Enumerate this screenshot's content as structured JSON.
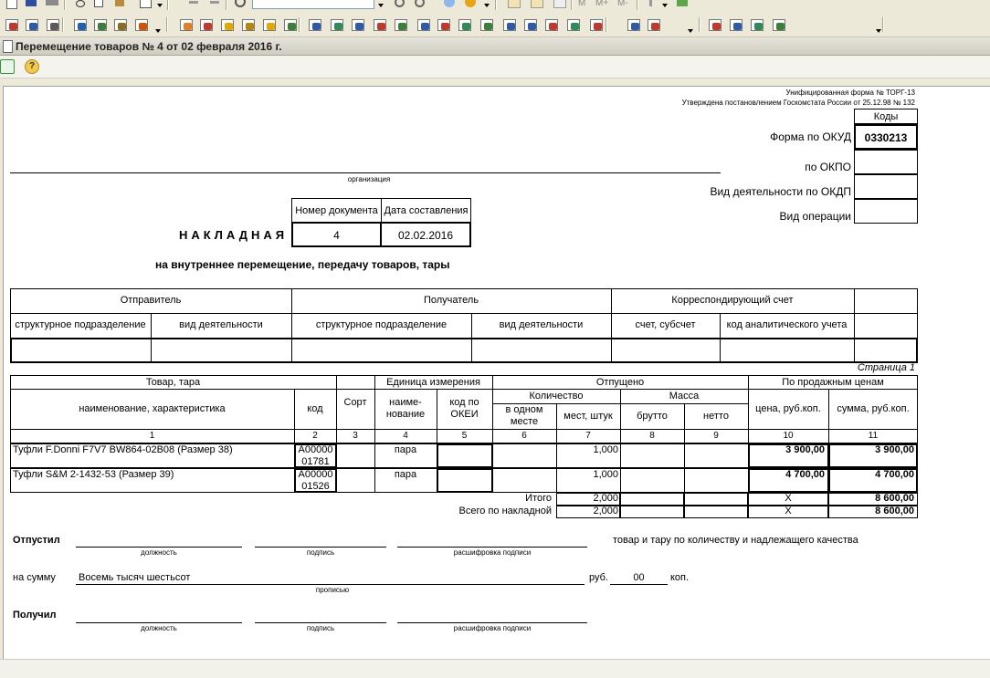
{
  "window": {
    "title": "Перемещение товаров № 4 от 02 февраля 2016 г."
  },
  "form": {
    "header_line1": "Унифицированная форма № ТОРГ-13",
    "header_line2": "Утверждена постановлением Госкомстата России от 25.12.98 № 132",
    "codes_label": "Коды",
    "okud_label": "Форма по ОКУД",
    "okud_value": "0330213",
    "okpo_label": "по ОКПО",
    "okdp_label": "Вид деятельности по ОКДП",
    "op_label": "Вид операции",
    "org_caption": "организация",
    "doc_number_label": "Номер документа",
    "doc_date_label": "Дата составления",
    "doc_number": "4",
    "doc_date": "02.02.2016",
    "title": "НАКЛАДНАЯ",
    "subtitle": "на внутреннее перемещение, передачу товаров, тары",
    "parties": {
      "sender": "Отправитель",
      "receiver": "Получатель",
      "corr_account": "Корреспондирующий счет",
      "struct_unit": "структурное подразделение",
      "activity": "вид деятельности",
      "account": "счет, субсчет",
      "analytic_code": "код аналитического учета"
    },
    "page_label": "Страница 1",
    "table": {
      "goods": "Товар, тара",
      "name_char": "наименование, характеристика",
      "code": "код",
      "grade": "Сорт",
      "unit": "Единица измерения",
      "unit_name": "наиме-нование",
      "okei": "код по ОКЕИ",
      "released": "Отпущено",
      "quantity": "Количество",
      "per_place": "в одном месте",
      "places": "мест, штук",
      "mass": "Масса",
      "gross": "брутто",
      "net": "нетто",
      "sale_prices": "По продажным ценам",
      "price": "цена, руб.коп.",
      "sum": "сумма, руб.коп.",
      "colnums": [
        "1",
        "2",
        "3",
        "4",
        "5",
        "6",
        "7",
        "8",
        "9",
        "10",
        "11"
      ],
      "rows": [
        {
          "name": "Туфли F.Donni F7V7 BW864-02B08 (Размер 38)",
          "code1": "А00000",
          "code2": "01781",
          "unit": "пара",
          "places": "1,000",
          "price": "3 900,00",
          "sum": "3 900,00"
        },
        {
          "name": "Туфли S&M 2-1432-53 (Размер 39)",
          "code1": "А00000",
          "code2": "01526",
          "unit": "пара",
          "places": "1,000",
          "price": "4 700,00",
          "sum": "4 700,00"
        }
      ],
      "total_label": "Итого",
      "total_places": "2,000",
      "total_price": "Х",
      "total_sum": "8 600,00",
      "grand_label": "Всего по накладной",
      "grand_places": "2,000",
      "grand_price": "Х",
      "grand_sum": "8 600,00"
    },
    "released_by": "Отпустил",
    "position": "должность",
    "signature": "подпись",
    "signature_decode": "расшифровка подписи",
    "quality_text": "товар и тару по количеству и надлежащего качества",
    "on_sum": "на сумму",
    "sum_words": "Восемь тысяч шестьсот",
    "in_words": "прописью",
    "rub": "руб.",
    "kop_value": "00",
    "kop": "коп.",
    "received_by": "Получил"
  },
  "icons": {
    "toolbar1": [
      "new-doc-icon",
      "save-icon",
      "print-icon",
      "cut-icon",
      "copy-icon",
      "paste-icon",
      "print-preview-icon",
      "undo-icon",
      "redo-icon",
      "search-icon",
      "find-next-icon",
      "find-prev-icon",
      "info-icon",
      "table-icon",
      "calc-icon",
      "memory-m-icon",
      "memory-mplus-icon",
      "memory-mminus-icon",
      "pin-icon",
      "help-icon"
    ],
    "toolbar2": [
      "book-red-icon",
      "book-stack-icon",
      "printer-icon",
      "people-icon",
      "registers-icon",
      "chart-edit-icon",
      "orders-icon",
      "orders-open-icon",
      "hand-money-icon",
      "doc-gold-icon",
      "bank-icon",
      "cash-in-icon",
      "money-bag-icon",
      "transfer-icon",
      "invoice-icon",
      "doc-check-icon",
      "goods-in-icon",
      "goods-out-icon",
      "delivery-icon",
      "box-plus-icon",
      "box-arrow-icon",
      "doc-green-icon",
      "doc-blue-icon",
      "report-icon",
      "doc-red-icon",
      "calc-doc-icon",
      "users-icon",
      "user-doc-icon",
      "user-edit-icon",
      "report-red-icon",
      "report-graph-icon",
      "report-check-icon",
      "pen-doc-icon"
    ]
  }
}
